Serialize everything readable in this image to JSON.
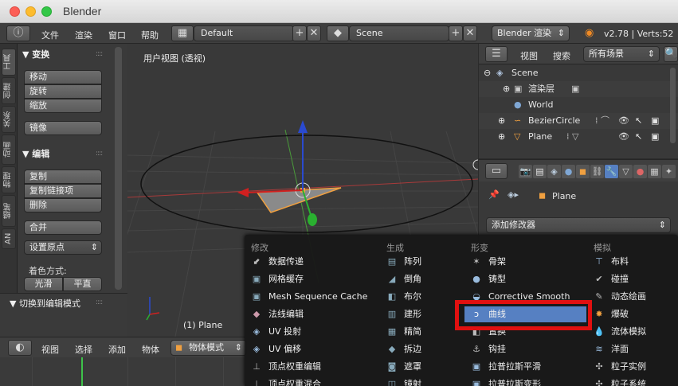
{
  "window": {
    "title": "Blender"
  },
  "top_header": {
    "menus": [
      "文件",
      "渲染",
      "窗口",
      "帮助"
    ],
    "layout": "Default",
    "scene": "Scene",
    "engine": "Blender 渲染",
    "version": "v2.78 | Verts:52"
  },
  "tool_tabs": [
    "工具",
    "创建",
    "关系",
    "动画",
    "物理",
    "蜡笔",
    "AN"
  ],
  "tool_shelf": {
    "transform_title": "▼ 变换",
    "transform_buttons": [
      "移动",
      "旋转",
      "缩放"
    ],
    "mirror": "镜像",
    "edit_title": "▼ 编辑",
    "edit_buttons": [
      "复制",
      "复制链接项",
      "删除"
    ],
    "join": "合并",
    "set_origin": "设置原点",
    "shading_label": "着色方式:",
    "smooth": "光滑",
    "flat": "平直",
    "toggle_edit": "▼ 切换到编辑模式"
  },
  "viewport": {
    "label": "用户视图 (透视)",
    "object_label": "(1) Plane"
  },
  "outliner": {
    "view": "视图",
    "search": "搜索",
    "filter": "所有场景",
    "items": [
      {
        "name": "Scene",
        "indent": 0
      },
      {
        "name": "渲染层",
        "indent": 1
      },
      {
        "name": "World",
        "indent": 1
      },
      {
        "name": "BezierCircle",
        "indent": 1
      },
      {
        "name": "Plane",
        "indent": 1
      }
    ]
  },
  "properties": {
    "object_name": "Plane",
    "add_modifier": "添加修改器"
  },
  "bottom_header": {
    "menus": [
      "视图",
      "选择",
      "添加",
      "物体"
    ],
    "mode": "物体模式"
  },
  "modifier_menu": {
    "columns": [
      {
        "title": "修改",
        "items": [
          "数据传递",
          "网格缓存",
          "Mesh Sequence Cache",
          "法线编辑",
          "UV 投射",
          "UV 偏移",
          "顶点权重编辑",
          "顶点权重混合"
        ]
      },
      {
        "title": "生成",
        "items": [
          "阵列",
          "倒角",
          "布尔",
          "建形",
          "精简",
          "拆边",
          "遮罩",
          "镜射"
        ]
      },
      {
        "title": "形变",
        "items": [
          "骨架",
          "铸型",
          "Corrective Smooth",
          "曲线",
          "置换",
          "钩挂",
          "拉普拉斯平滑",
          "拉普拉斯变形"
        ]
      },
      {
        "title": "模拟",
        "items": [
          "布料",
          "碰撞",
          "动态绘画",
          "爆破",
          "流体模拟",
          "洋面",
          "粒子实例",
          "粒子系统"
        ]
      }
    ],
    "highlighted": "曲线"
  },
  "colors": {
    "highlight": "#5680c2",
    "annotation_box": "#e01010",
    "object_orange": "#f0a040"
  }
}
